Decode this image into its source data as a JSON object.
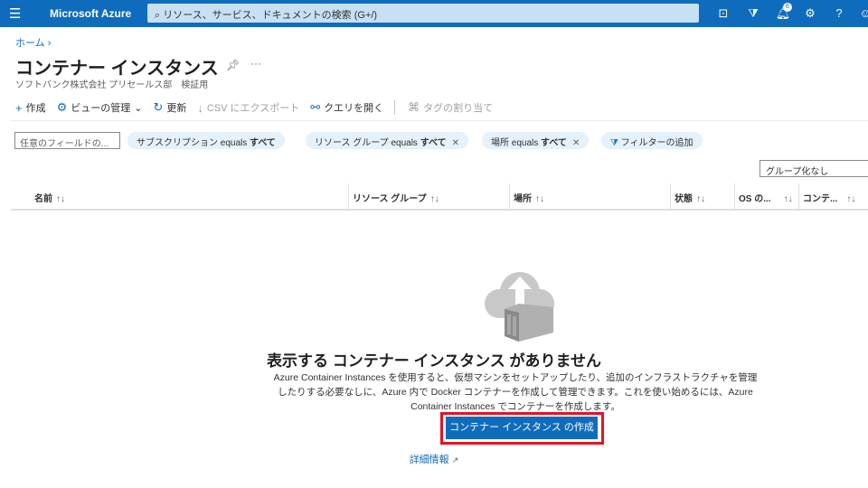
{
  "topbar": {
    "brand": "Microsoft Azure",
    "search_placeholder": "リソース、サービス、ドキュメントの検索 (G+/)",
    "notification_count": "6"
  },
  "breadcrumb": {
    "home": "ホーム"
  },
  "page": {
    "title": "コンテナー インスタンス",
    "subtitle": "ソフトバンク株式会社 プリセールス部　検証用"
  },
  "toolbar": {
    "create": "作成",
    "manage_view": "ビューの管理",
    "refresh": "更新",
    "export_csv": "CSV にエクスポート",
    "open_query": "クエリを開く",
    "assign_tags": "タグの割り当て"
  },
  "filters": {
    "field_placeholder": "任意のフィールドの...",
    "subscription": {
      "label": "サブスクリプション equals ",
      "value": "すべて"
    },
    "resource_group": {
      "label": "リソース グループ equals ",
      "value": "すべて"
    },
    "location": {
      "label": "場所 equals ",
      "value": "すべて"
    },
    "add_filter": "フィルターの追加"
  },
  "grouping": {
    "selected": "グループ化なし"
  },
  "table": {
    "columns": [
      "名前",
      "リソース グループ",
      "場所",
      "状態",
      "OS の...",
      "コンテ..."
    ]
  },
  "empty_state": {
    "heading": "表示する コンテナー インスタンス がありません",
    "description": "Azure Container Instances を使用すると、仮想マシンをセットアップしたり、追加のインフラストラクチャを管理したりする必要なしに、Azure 内で Docker コンテナーを作成して管理できます。これを使い始めるには、Azure Container Instances でコンテナーを作成します。",
    "create_button": "コンテナー インスタンス の作成",
    "learn_more": "詳細情報"
  },
  "colors": {
    "brand": "#0f6cbd",
    "highlight": "#e81123"
  }
}
